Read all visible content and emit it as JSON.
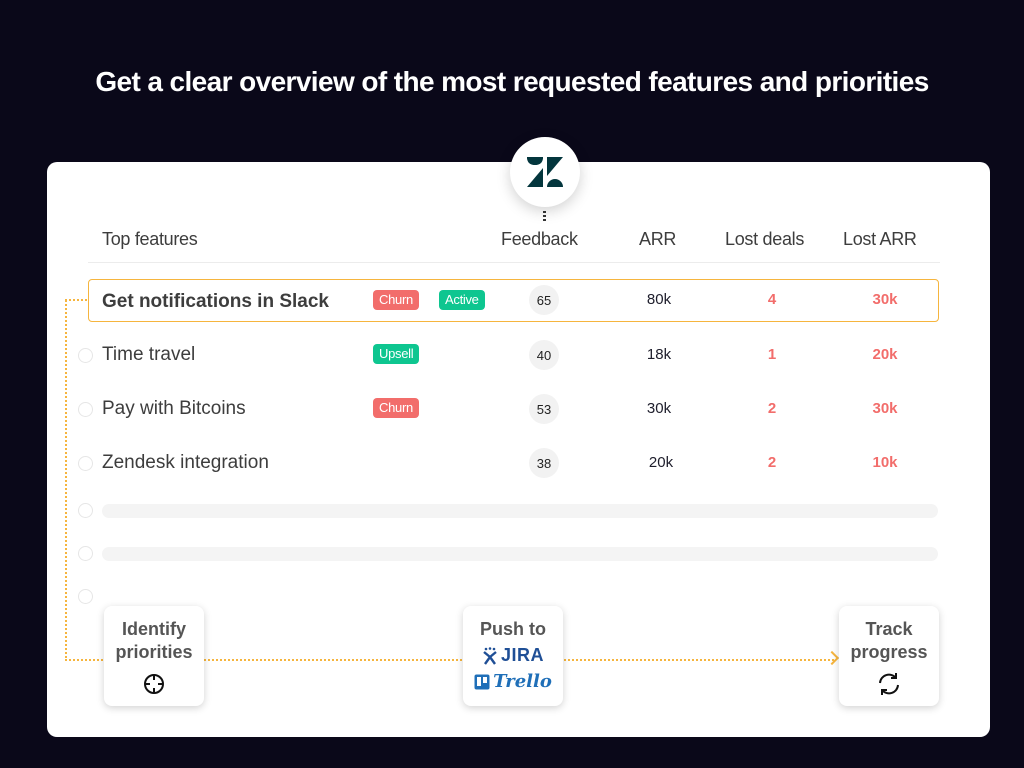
{
  "headline": "Get a clear overview of the most requested features and priorities",
  "integration_logo": "zendesk-logo",
  "table": {
    "headers": {
      "feature": "Top features",
      "feedback": "Feedback",
      "arr": "ARR",
      "lost_deals": "Lost deals",
      "lost_arr": "Lost ARR"
    },
    "rows": [
      {
        "name": "Get notifications in Slack",
        "tags": [
          {
            "label": "Churn",
            "type": "churn"
          },
          {
            "label": "Active",
            "type": "active"
          }
        ],
        "feedback": "65",
        "arr": "80k",
        "lost_deals": "4",
        "lost_arr": "30k",
        "highlighted": true
      },
      {
        "name": "Time travel",
        "tags": [
          {
            "label": "Upsell",
            "type": "upsell"
          }
        ],
        "feedback": "40",
        "arr": "18k",
        "lost_deals": "1",
        "lost_arr": "20k",
        "highlighted": false
      },
      {
        "name": "Pay with Bitcoins",
        "tags": [
          {
            "label": "Churn",
            "type": "churn"
          }
        ],
        "feedback": "53",
        "arr": "30k",
        "lost_deals": "2",
        "lost_arr": "30k",
        "highlighted": false
      },
      {
        "name": "Zendesk integration",
        "tags": [],
        "feedback": "38",
        "arr": "20k",
        "lost_deals": "2",
        "lost_arr": "10k",
        "highlighted": false
      }
    ]
  },
  "steps": {
    "identify": {
      "line1": "Identify",
      "line2": "priorities",
      "icon": "crosshair-icon"
    },
    "push": {
      "label": "Push to",
      "jira": "JIRA",
      "trello": "Trello"
    },
    "track": {
      "line1": "Track",
      "line2": "progress",
      "icon": "sync-icon"
    }
  },
  "colors": {
    "background": "#0a0819",
    "accent_flow": "#f6b53e",
    "churn": "#f26d6b",
    "active": "#0ec690",
    "lost_values": "#f26d6b",
    "zendesk": "#03363d"
  }
}
